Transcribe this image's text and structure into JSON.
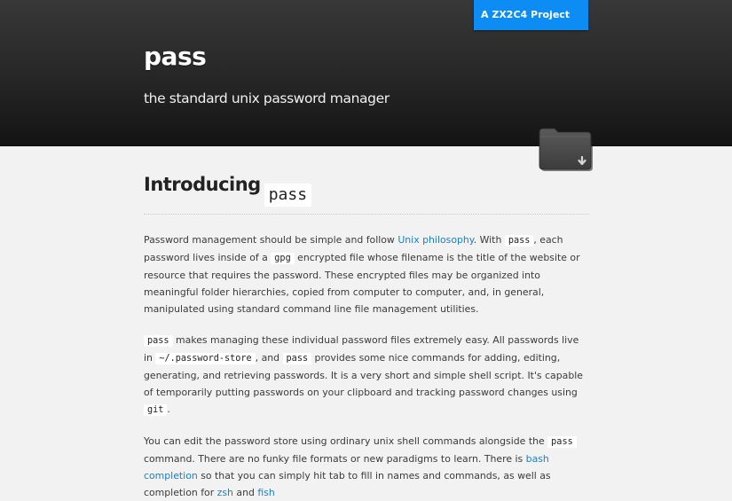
{
  "header": {
    "project_link": "A ZX2C4 Project",
    "title": "pass",
    "tagline": "the standard unix password manager",
    "download_icon": "folder-download-icon"
  },
  "intro": {
    "heading": "Introducing",
    "heading_code": "pass"
  },
  "para1": {
    "t1": "Password management should be simple and follow ",
    "link_unix": "Unix philosophy",
    "t2": ". With ",
    "code_pass": "pass",
    "t3": ", each password lives inside of a ",
    "code_gpg": "gpg",
    "t4": " encrypted file whose filename is the title of the website or resource that requires the password. These encrypted files may be organized into meaningful folder hierarchies, copied from computer to computer, and, in general, manipulated using standard command line file management utilities."
  },
  "para2": {
    "code_pass": "pass",
    "t1": " makes managing these individual password files extremely easy. All passwords live in ",
    "code_store": "~/.password-store",
    "t2": ", and ",
    "code_pass2": "pass",
    "t3": " provides some nice commands for adding, editing, generating, and retrieving passwords. It is a very short and simple shell script. It's capable of temporarily putting passwords on your clipboard and tracking password changes using ",
    "code_git": "git",
    "t4": "."
  },
  "para3": {
    "t1": "You can edit the password store using ordinary unix shell commands alongside the ",
    "code_pass": "pass",
    "t2": " command. There are no funky file formats or new paradigms to learn. There is ",
    "link_bash": "bash completion",
    "t3": " so that you can simply hit tab to fill in names and commands, as well as completion for ",
    "link_zsh": "zsh",
    "t4": " and ",
    "link_fish": "fish"
  }
}
